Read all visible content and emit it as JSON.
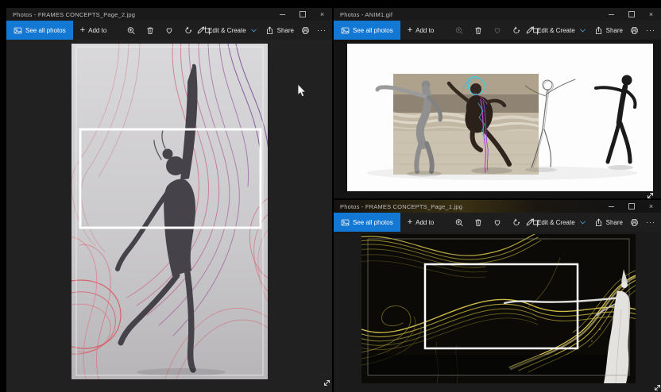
{
  "desktop": {
    "background": "#000000"
  },
  "chrome": {
    "close_glyph": "×"
  },
  "toolbar": {
    "see_all_photos": "See all photos",
    "add_to": "Add to",
    "add_glyph": "+",
    "edit_create": "Edit & Create",
    "share": "Share",
    "more_glyph": "···"
  },
  "colors": {
    "accent_button": "#1377d4",
    "edit_create_chevron": "#58a6e0",
    "titlebar": "#1a1a1a",
    "toolbar_bg": "#1e1e1e",
    "selection_rectangle": "#ffffff",
    "left_photo_lines": "#d4607a",
    "bottom_photo_lines": "#c9b544"
  },
  "windows": [
    {
      "title": "Photos - FRAMES CONCEPTS_Page_2.jpg"
    },
    {
      "title": "Photos - ANIM1.gif"
    },
    {
      "title": "Photos - FRAMES CONCEPTS_Page_1.jpg"
    }
  ]
}
